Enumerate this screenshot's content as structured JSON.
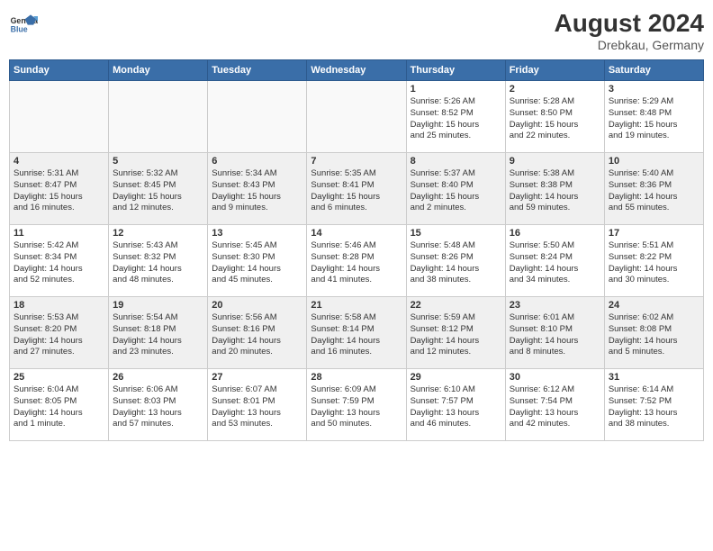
{
  "header": {
    "logo_general": "General",
    "logo_blue": "Blue",
    "month_year": "August 2024",
    "location": "Drebkau, Germany"
  },
  "weekdays": [
    "Sunday",
    "Monday",
    "Tuesday",
    "Wednesday",
    "Thursday",
    "Friday",
    "Saturday"
  ],
  "weeks": [
    [
      {
        "day": "",
        "info": ""
      },
      {
        "day": "",
        "info": ""
      },
      {
        "day": "",
        "info": ""
      },
      {
        "day": "",
        "info": ""
      },
      {
        "day": "1",
        "info": "Sunrise: 5:26 AM\nSunset: 8:52 PM\nDaylight: 15 hours\nand 25 minutes."
      },
      {
        "day": "2",
        "info": "Sunrise: 5:28 AM\nSunset: 8:50 PM\nDaylight: 15 hours\nand 22 minutes."
      },
      {
        "day": "3",
        "info": "Sunrise: 5:29 AM\nSunset: 8:48 PM\nDaylight: 15 hours\nand 19 minutes."
      }
    ],
    [
      {
        "day": "4",
        "info": "Sunrise: 5:31 AM\nSunset: 8:47 PM\nDaylight: 15 hours\nand 16 minutes."
      },
      {
        "day": "5",
        "info": "Sunrise: 5:32 AM\nSunset: 8:45 PM\nDaylight: 15 hours\nand 12 minutes."
      },
      {
        "day": "6",
        "info": "Sunrise: 5:34 AM\nSunset: 8:43 PM\nDaylight: 15 hours\nand 9 minutes."
      },
      {
        "day": "7",
        "info": "Sunrise: 5:35 AM\nSunset: 8:41 PM\nDaylight: 15 hours\nand 6 minutes."
      },
      {
        "day": "8",
        "info": "Sunrise: 5:37 AM\nSunset: 8:40 PM\nDaylight: 15 hours\nand 2 minutes."
      },
      {
        "day": "9",
        "info": "Sunrise: 5:38 AM\nSunset: 8:38 PM\nDaylight: 14 hours\nand 59 minutes."
      },
      {
        "day": "10",
        "info": "Sunrise: 5:40 AM\nSunset: 8:36 PM\nDaylight: 14 hours\nand 55 minutes."
      }
    ],
    [
      {
        "day": "11",
        "info": "Sunrise: 5:42 AM\nSunset: 8:34 PM\nDaylight: 14 hours\nand 52 minutes."
      },
      {
        "day": "12",
        "info": "Sunrise: 5:43 AM\nSunset: 8:32 PM\nDaylight: 14 hours\nand 48 minutes."
      },
      {
        "day": "13",
        "info": "Sunrise: 5:45 AM\nSunset: 8:30 PM\nDaylight: 14 hours\nand 45 minutes."
      },
      {
        "day": "14",
        "info": "Sunrise: 5:46 AM\nSunset: 8:28 PM\nDaylight: 14 hours\nand 41 minutes."
      },
      {
        "day": "15",
        "info": "Sunrise: 5:48 AM\nSunset: 8:26 PM\nDaylight: 14 hours\nand 38 minutes."
      },
      {
        "day": "16",
        "info": "Sunrise: 5:50 AM\nSunset: 8:24 PM\nDaylight: 14 hours\nand 34 minutes."
      },
      {
        "day": "17",
        "info": "Sunrise: 5:51 AM\nSunset: 8:22 PM\nDaylight: 14 hours\nand 30 minutes."
      }
    ],
    [
      {
        "day": "18",
        "info": "Sunrise: 5:53 AM\nSunset: 8:20 PM\nDaylight: 14 hours\nand 27 minutes."
      },
      {
        "day": "19",
        "info": "Sunrise: 5:54 AM\nSunset: 8:18 PM\nDaylight: 14 hours\nand 23 minutes."
      },
      {
        "day": "20",
        "info": "Sunrise: 5:56 AM\nSunset: 8:16 PM\nDaylight: 14 hours\nand 20 minutes."
      },
      {
        "day": "21",
        "info": "Sunrise: 5:58 AM\nSunset: 8:14 PM\nDaylight: 14 hours\nand 16 minutes."
      },
      {
        "day": "22",
        "info": "Sunrise: 5:59 AM\nSunset: 8:12 PM\nDaylight: 14 hours\nand 12 minutes."
      },
      {
        "day": "23",
        "info": "Sunrise: 6:01 AM\nSunset: 8:10 PM\nDaylight: 14 hours\nand 8 minutes."
      },
      {
        "day": "24",
        "info": "Sunrise: 6:02 AM\nSunset: 8:08 PM\nDaylight: 14 hours\nand 5 minutes."
      }
    ],
    [
      {
        "day": "25",
        "info": "Sunrise: 6:04 AM\nSunset: 8:05 PM\nDaylight: 14 hours\nand 1 minute."
      },
      {
        "day": "26",
        "info": "Sunrise: 6:06 AM\nSunset: 8:03 PM\nDaylight: 13 hours\nand 57 minutes."
      },
      {
        "day": "27",
        "info": "Sunrise: 6:07 AM\nSunset: 8:01 PM\nDaylight: 13 hours\nand 53 minutes."
      },
      {
        "day": "28",
        "info": "Sunrise: 6:09 AM\nSunset: 7:59 PM\nDaylight: 13 hours\nand 50 minutes."
      },
      {
        "day": "29",
        "info": "Sunrise: 6:10 AM\nSunset: 7:57 PM\nDaylight: 13 hours\nand 46 minutes."
      },
      {
        "day": "30",
        "info": "Sunrise: 6:12 AM\nSunset: 7:54 PM\nDaylight: 13 hours\nand 42 minutes."
      },
      {
        "day": "31",
        "info": "Sunrise: 6:14 AM\nSunset: 7:52 PM\nDaylight: 13 hours\nand 38 minutes."
      }
    ]
  ]
}
